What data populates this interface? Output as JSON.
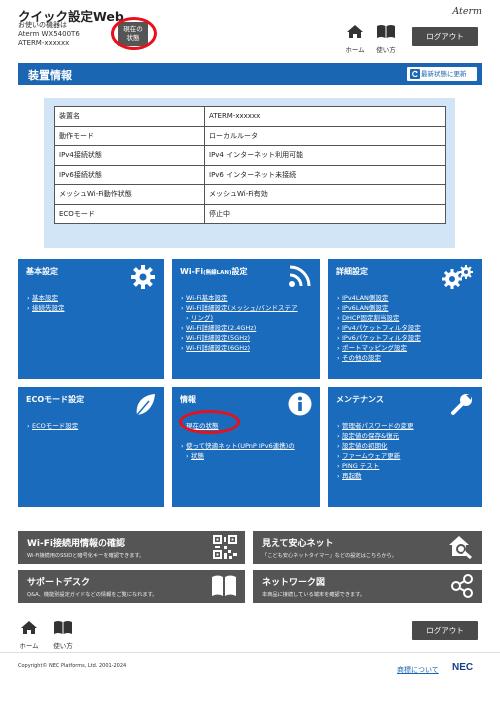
{
  "header": {
    "app_title": "クイック設定Web",
    "device_caption": "お使いの機器は",
    "model": "Aterm WX5400T6",
    "device_name": "ATERM-xxxxxx",
    "status_button": [
      "現在の",
      "状態"
    ],
    "brand": "Aterm",
    "home_label": "ホーム",
    "howto_label": "使い方",
    "logout_label": "ログアウト"
  },
  "device_info": {
    "title": "装置情報",
    "refresh_label": "最新状態に更新",
    "rows": [
      {
        "key": "装置名",
        "value": "ATERM-xxxxxx"
      },
      {
        "key": "動作モード",
        "value": "ローカルルータ"
      },
      {
        "key": "IPv4接続状態",
        "value": "IPv4 インターネット利用可能"
      },
      {
        "key": "IPv6接続状態",
        "value": "IPv6 インターネット未接続"
      },
      {
        "key": "メッシュWi-Fi動作状態",
        "value": "メッシュWi-Fi有効"
      },
      {
        "key": "ECOモード",
        "value": "停止中"
      }
    ]
  },
  "tiles": {
    "basic": {
      "title": "基本設定",
      "icon": "gear-icon",
      "links": [
        "基本設定",
        "接続先設定"
      ]
    },
    "wifi": {
      "title": "Wi-Fi",
      "title_small": "(無線LAN)",
      "title_suffix": "設定",
      "icon": "wifi-icon",
      "links": [
        "Wi-Fi基本設定",
        "Wi-Fi詳細設定(メッシュ/バンドステア",
        "リング)",
        "Wi-Fi詳細設定(2.4GHz)",
        "Wi-Fi詳細設定(5GHz)",
        "Wi-Fi詳細設定(6GHz)"
      ]
    },
    "advanced": {
      "title": "詳細設定",
      "icon": "gears-icon",
      "links": [
        "IPv4LAN側設定",
        "IPv6LAN側設定",
        "DHCP固定割当設定",
        "IPv4パケットフィルタ設定",
        "IPv6パケットフィルタ設定",
        "ポートマッピング設定",
        "その他の設定"
      ]
    },
    "eco": {
      "title": "ECOモード設定",
      "icon": "leaf-icon",
      "links": [
        "ECOモード設定"
      ]
    },
    "info": {
      "title": "情報",
      "icon": "info-icon",
      "links": [
        "現在の状態",
        "使って快適ネット(UPnP IPv6連携)の",
        "状態"
      ]
    },
    "maintenance": {
      "title": "メンテナンス",
      "icon": "wrench-icon",
      "links": [
        "管理者パスワードの変更",
        "設定値の保存&復元",
        "設定値の初期化",
        "ファームウェア更新",
        "PING テスト",
        "再起動"
      ]
    }
  },
  "banners": {
    "wifi_check": {
      "title": "Wi-Fi接続用情報の確認",
      "sub": "Wi-Fi接続用のSSIDと暗号化キーを確認できます。",
      "icon": "qr-code-icon"
    },
    "safety_net": {
      "title": "見えて安心ネット",
      "sub": "「こども安心ネットタイマー」などの設定はこちらから。",
      "icon": "home-search-icon"
    },
    "support": {
      "title": "サポートデスク",
      "sub": "Q&A、機能別設定ガイドなどの情報をご覧になれます。",
      "icon": "book-icon"
    },
    "network_map": {
      "title": "ネットワーク図",
      "sub": "本商品に接続している端末を確認できます。",
      "icon": "share-nodes-icon"
    }
  },
  "footer": {
    "home_label": "ホーム",
    "howto_label": "使い方",
    "logout_label": "ログアウト",
    "copyright": "Copyright© NEC Platforms, Ltd. 2001-2024",
    "trademark_link": "商標について",
    "logo": "NEC"
  },
  "colors": {
    "accent_blue": "#1b6bbd",
    "highlight_red": "#e8101a",
    "banner_gray": "#555555"
  }
}
